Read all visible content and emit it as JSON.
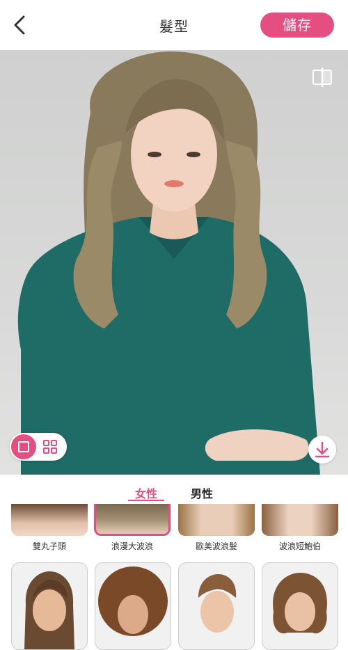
{
  "header": {
    "title": "髮型",
    "save_label": "儲存"
  },
  "tabs": {
    "female": "女性",
    "male": "男性"
  },
  "styles_row1": [
    {
      "label": "雙丸子頭"
    },
    {
      "label": "浪漫大波浪"
    },
    {
      "label": "歐美波浪髮"
    },
    {
      "label": "波浪短鮑伯"
    }
  ],
  "colors": {
    "accent": "#e54e80",
    "shirt": "#1f6b66",
    "hair": "#8a7a5c"
  },
  "icons": [
    "back-arrow-icon",
    "compare-icon",
    "single-view-icon",
    "grid-view-icon",
    "download-icon"
  ]
}
